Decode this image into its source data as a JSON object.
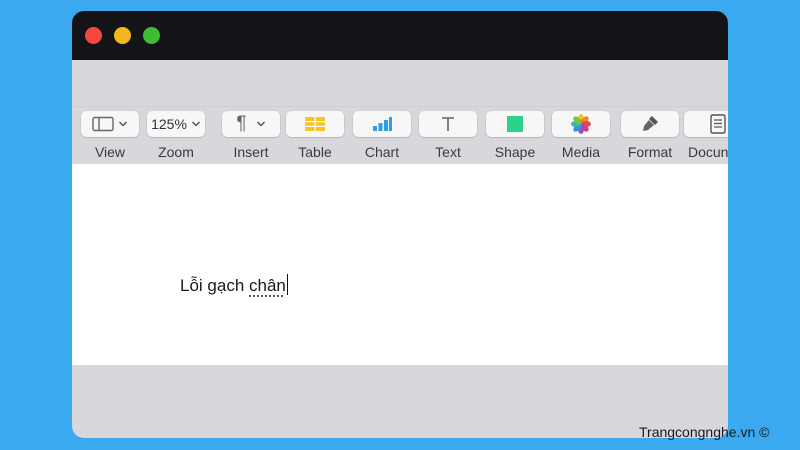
{
  "toolbar": {
    "items": [
      {
        "label": "View",
        "icon": "view-sidebar-icon"
      },
      {
        "label": "Zoom",
        "value": "125%",
        "icon": "chevron-down-icon"
      },
      {
        "label": "Insert",
        "icon": "pilcrow-icon"
      },
      {
        "label": "Table",
        "icon": "table-icon"
      },
      {
        "label": "Chart",
        "icon": "bar-chart-icon"
      },
      {
        "label": "Text",
        "icon": "text-box-icon"
      },
      {
        "label": "Shape",
        "icon": "square-shape-icon"
      },
      {
        "label": "Media",
        "icon": "photos-flower-icon"
      },
      {
        "label": "Format",
        "icon": "paintbrush-icon"
      },
      {
        "label": "Docun",
        "icon": "document-icon"
      }
    ]
  },
  "document": {
    "text_plain": "Lỗi gạch ",
    "text_flagged": "chân"
  },
  "watermark": "Trangcongnghe.vn ©",
  "colors": {
    "background": "#3aa9f0",
    "titlebar": "#141418",
    "close": "#f2473f",
    "minimize": "#f4b620",
    "maximize": "#3cbd34",
    "table_icon": "#f7c325",
    "chart_icon": "#2f9ee8",
    "shape_icon": "#2fcf8e"
  }
}
